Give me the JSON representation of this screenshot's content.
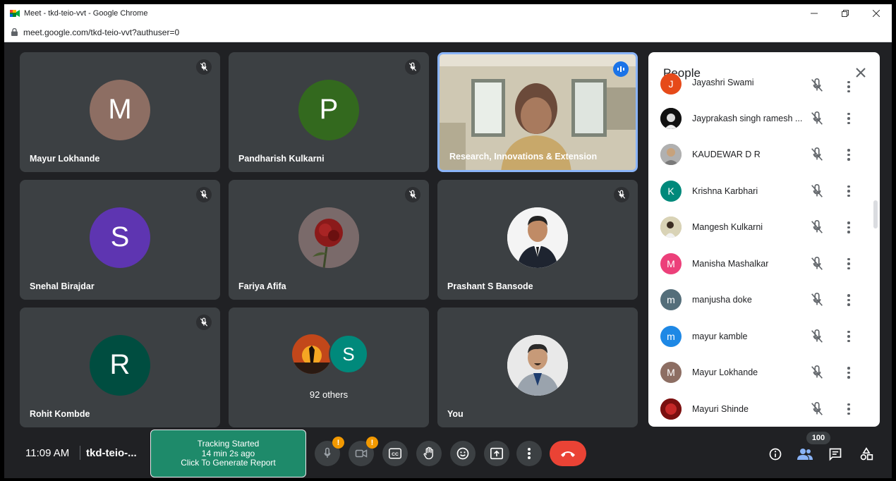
{
  "browser": {
    "window_title": "Meet - tkd-teio-vvt - Google Chrome",
    "url": "meet.google.com/tkd-teio-vvt?authuser=0",
    "controls": [
      "minimize",
      "restore",
      "close"
    ]
  },
  "tiles": [
    {
      "name": "Mayur Lokhande",
      "initial": "M",
      "color": "#8d6e63",
      "muted": true
    },
    {
      "name": "Pandharish Kulkarni",
      "initial": "P",
      "color": "#33691e",
      "muted": true
    },
    {
      "name": "Research, Innovations & Extension",
      "initial": "",
      "color": "",
      "muted": false,
      "speaking": true,
      "video": true
    },
    {
      "name": "Snehal Birajdar",
      "initial": "S",
      "color": "#5e35b1",
      "muted": true
    },
    {
      "name": "Fariya Afifa",
      "initial": "",
      "color": "",
      "muted": true,
      "photo": "rose"
    },
    {
      "name": "Prashant S Bansode",
      "initial": "",
      "color": "",
      "muted": true,
      "photo": "man-suit"
    },
    {
      "name": "Rohit Kombde",
      "initial": "R",
      "color": "#004d40",
      "muted": true
    },
    {
      "name": "",
      "others_label": "92 others",
      "initial": "S",
      "color": "#00897b",
      "muted": false
    },
    {
      "name": "You",
      "initial": "",
      "color": "",
      "muted": false,
      "photo": "man-blazer"
    }
  ],
  "people_panel": {
    "title": "People",
    "participants": [
      {
        "name": "Jayashri Swami",
        "initial": "J",
        "color": "#e64a19"
      },
      {
        "name": "Jayprakash singh ramesh ...",
        "initial": "",
        "color": "#111111",
        "photo": true
      },
      {
        "name": "KAUDEWAR D R",
        "initial": "",
        "color": "#9e9e9e",
        "photo": true
      },
      {
        "name": "Krishna Karbhari",
        "initial": "K",
        "color": "#00897b"
      },
      {
        "name": "Mangesh Kulkarni",
        "initial": "",
        "color": "#bdb38a",
        "photo": true
      },
      {
        "name": "Manisha Mashalkar",
        "initial": "M",
        "color": "#ec407a"
      },
      {
        "name": "manjusha doke",
        "initial": "m",
        "color": "#546e7a"
      },
      {
        "name": "mayur kamble",
        "initial": "m",
        "color": "#1e88e5"
      },
      {
        "name": "Mayur Lokhande",
        "initial": "M",
        "color": "#8d6e63"
      },
      {
        "name": "Mayuri Shinde",
        "initial": "",
        "color": "#b71c1c",
        "photo": true
      }
    ]
  },
  "bottom_bar": {
    "time": "11:09 AM",
    "meeting_code": "tkd-teio-...",
    "tracking": {
      "line1": "Tracking Started",
      "line2": "14 min 2s ago",
      "line3": "Click To Generate Report"
    },
    "mic_badge": "!",
    "cam_badge": "!",
    "participant_count": "100"
  }
}
